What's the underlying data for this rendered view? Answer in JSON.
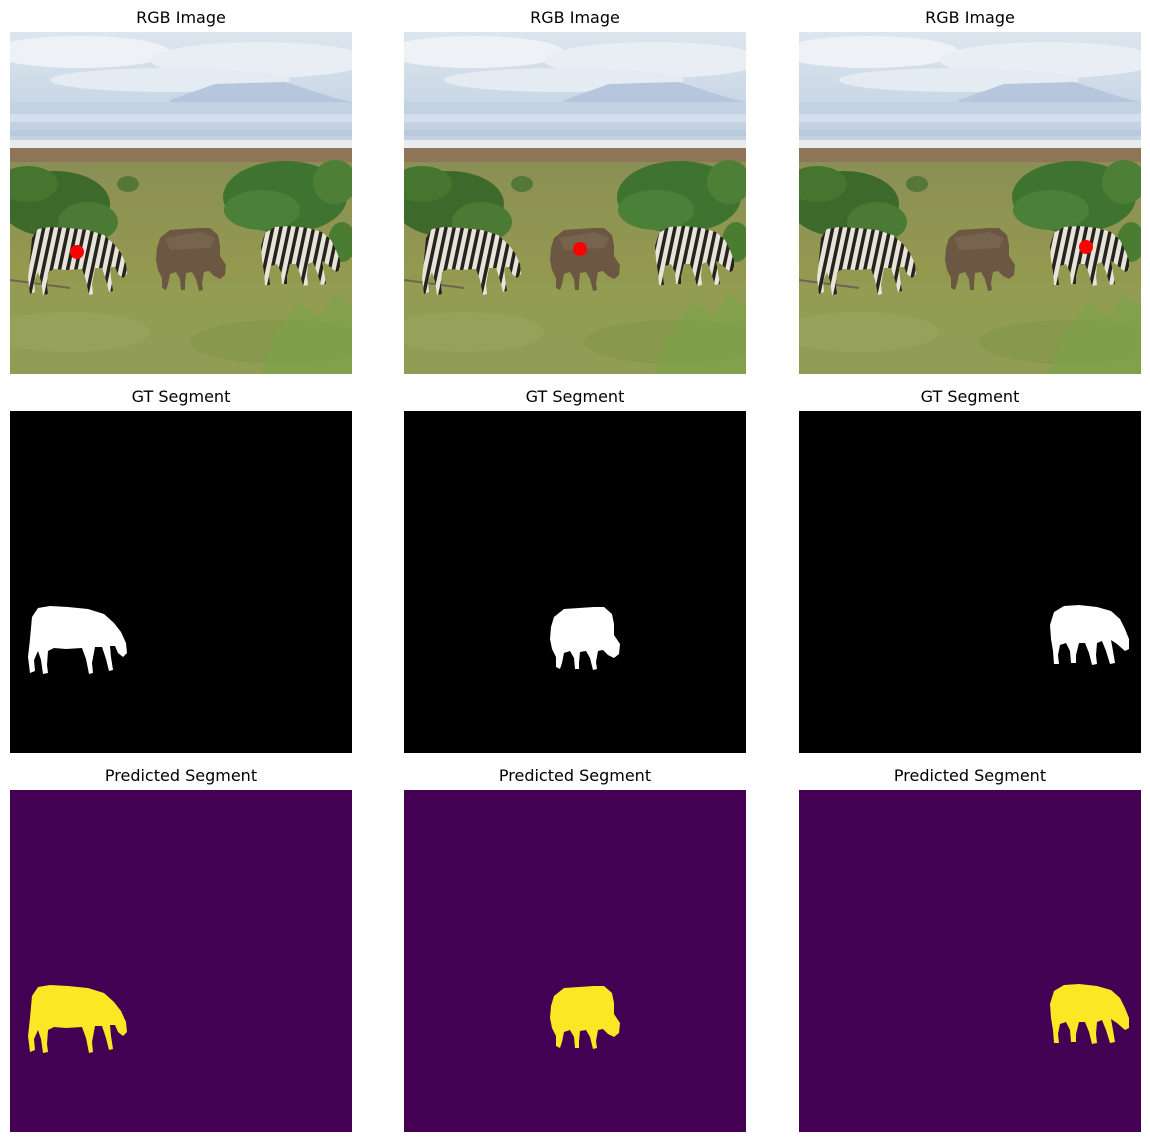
{
  "figure": {
    "rows": [
      {
        "title": "RGB Image",
        "kind": "rgb",
        "panels": [
          {
            "marker_target": "left zebra"
          },
          {
            "marker_target": "wildebeest"
          },
          {
            "marker_target": "right zebra"
          }
        ]
      },
      {
        "title": "GT Segment",
        "kind": "gt",
        "panels": [
          {
            "segmented_object": "left zebra"
          },
          {
            "segmented_object": "wildebeest"
          },
          {
            "segmented_object": "right zebra"
          }
        ]
      },
      {
        "title": "Predicted Segment",
        "kind": "pred",
        "panels": [
          {
            "segmented_object": "left zebra"
          },
          {
            "segmented_object": "wildebeest"
          },
          {
            "segmented_object": "right zebra"
          }
        ]
      }
    ],
    "colors": {
      "marker": "#ff0000",
      "gt_background": "#000000",
      "gt_mask": "#ffffff",
      "pred_background": "#440154",
      "pred_mask": "#fde725"
    }
  }
}
